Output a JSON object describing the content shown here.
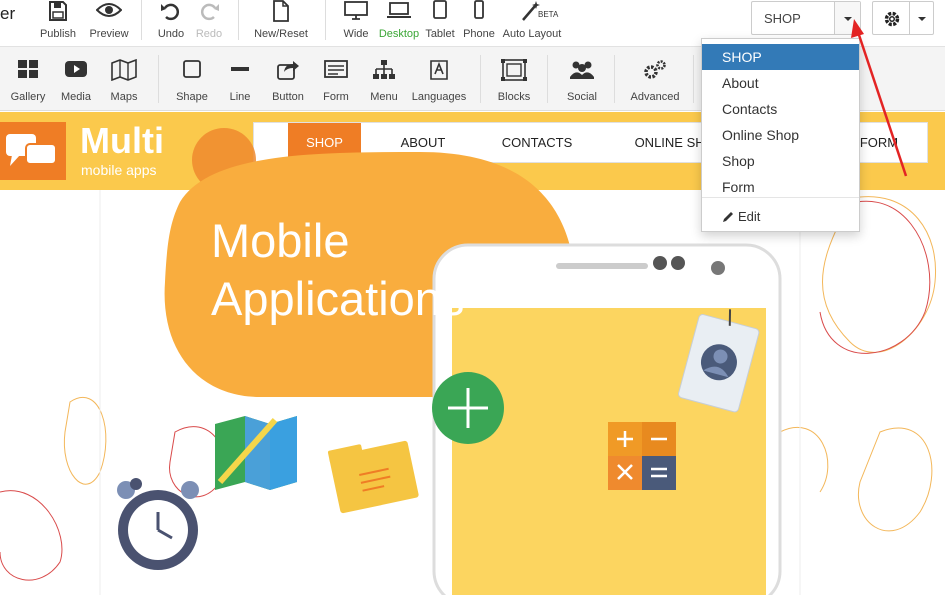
{
  "toolbar": {
    "partial_brand": "er",
    "top": [
      {
        "id": "publish",
        "label": "Publish"
      },
      {
        "id": "preview",
        "label": "Preview"
      },
      {
        "id": "undo",
        "label": "Undo"
      },
      {
        "id": "redo",
        "label": "Redo"
      },
      {
        "id": "new_reset",
        "label": "New/Reset"
      },
      {
        "id": "wide",
        "label": "Wide"
      },
      {
        "id": "desktop",
        "label": "Desktop"
      },
      {
        "id": "tablet",
        "label": "Tablet"
      },
      {
        "id": "phone",
        "label": "Phone"
      },
      {
        "id": "auto_layout",
        "label": "Auto Layout",
        "badge": "BETA"
      }
    ],
    "insert": [
      {
        "id": "gallery",
        "label": "Gallery"
      },
      {
        "id": "media",
        "label": "Media"
      },
      {
        "id": "maps",
        "label": "Maps"
      },
      {
        "id": "shape",
        "label": "Shape"
      },
      {
        "id": "line",
        "label": "Line"
      },
      {
        "id": "button",
        "label": "Button"
      },
      {
        "id": "form",
        "label": "Form"
      },
      {
        "id": "menu",
        "label": "Menu"
      },
      {
        "id": "languages",
        "label": "Languages"
      },
      {
        "id": "blocks",
        "label": "Blocks"
      },
      {
        "id": "social",
        "label": "Social"
      },
      {
        "id": "advanced",
        "label": "Advanced"
      }
    ]
  },
  "page_selector": {
    "value": "SHOP",
    "options": [
      "SHOP",
      "About",
      "Contacts",
      "Online Shop",
      "Shop",
      "Form"
    ],
    "edit_label": "Edit"
  },
  "site": {
    "logo_title": "Multi",
    "logo_subtitle": "mobile apps",
    "nav": [
      "SHOP",
      "ABOUT",
      "CONTACTS",
      "ONLINE SHOP",
      "FORM"
    ],
    "headline_line1": "Mobile",
    "headline_line2": "Applications"
  },
  "colors": {
    "accent_blue": "#337ab7",
    "brand_orange": "#ef7d25",
    "header_yellow": "#fbc94c",
    "bubble_orange": "#f9ad3e",
    "active_green": "#3aa635"
  }
}
